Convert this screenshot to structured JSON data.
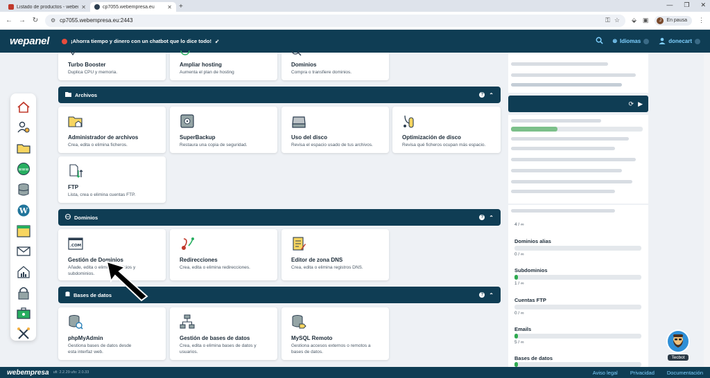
{
  "browser": {
    "tabs": [
      {
        "title": "Listado de productos - webem"
      },
      {
        "title": "cp7055.webempresa.eu"
      }
    ],
    "url": "cp7055.webempresa.eu:2443",
    "profile_label": "En pausa",
    "profile_initial": "J"
  },
  "header": {
    "logo": "wepanel",
    "promo": "¡Ahorra tiempo y dinero con un chatbot que lo dice todo!",
    "languages_label": "Idiomas",
    "user_label": "donecart"
  },
  "top_cards": [
    {
      "title": "Turbo Booster",
      "desc": "Duplica CPU y memoria."
    },
    {
      "title": "Ampliar hosting",
      "desc": "Aumenta el plan de hosting"
    },
    {
      "title": "Dominios",
      "desc": "Compra o transfiere dominios."
    }
  ],
  "sections": {
    "archivos": {
      "title": "Archivos",
      "cards": [
        {
          "title": "Administrador de archivos",
          "desc": "Crea, edita o elimina ficheros."
        },
        {
          "title": "SuperBackup",
          "desc": "Restaura una copia de seguridad."
        },
        {
          "title": "Uso del disco",
          "desc": "Revisa el espacio usado de tus archivos."
        },
        {
          "title": "Optimización de disco",
          "desc": "Revisa qué ficheros ocupan más espacio."
        },
        {
          "title": "FTP",
          "desc": "Lista, crea o elimina cuentas FTP."
        }
      ]
    },
    "dominios": {
      "title": "Dominios",
      "cards": [
        {
          "title": "Gestión de Dominios",
          "desc": "Añade, edita o elimina dominios y subdominios."
        },
        {
          "title": "Redirecciones",
          "desc": "Crea, edita o elimina redirecciones."
        },
        {
          "title": "Editor de zona DNS",
          "desc": "Crea, edita o elimina registros DNS."
        }
      ]
    },
    "bases": {
      "title": "Bases de datos",
      "cards": [
        {
          "title": "phpMyAdmin",
          "desc": "Gestiona bases de datos desde esta interfaz web."
        },
        {
          "title": "Gestión de bases de datos",
          "desc": "Crea, edita o elimina bases de datos y usuarios."
        },
        {
          "title": "MySQL Remoto",
          "desc": "Gestiona accesos externos o remotos a bases de datos."
        }
      ]
    }
  },
  "stats": {
    "partial_value": "4 / ∞",
    "items": [
      {
        "label": "Dominios alias",
        "value": "0 / ∞",
        "fill": 0
      },
      {
        "label": "Subdominios",
        "value": "1 / ∞",
        "fill": 0.03
      },
      {
        "label": "Cuentas FTP",
        "value": "0 / ∞",
        "fill": 0
      },
      {
        "label": "Emails",
        "value": "5 / ∞",
        "fill": 0.03
      },
      {
        "label": "Bases de datos",
        "value": "",
        "fill": 0.03
      }
    ],
    "usage_fill": 0.35
  },
  "footer": {
    "logo": "webempresa",
    "version": "ufi: 2.2.29  ufo: 2.0.33",
    "links": [
      "Aviso legal",
      "Privacidad",
      "Documentación"
    ]
  },
  "tecbot_label": "Tecbot",
  "colors": {
    "primary": "#0f3d54",
    "accent": "#7fd0ff",
    "success": "#2eaa4f"
  }
}
